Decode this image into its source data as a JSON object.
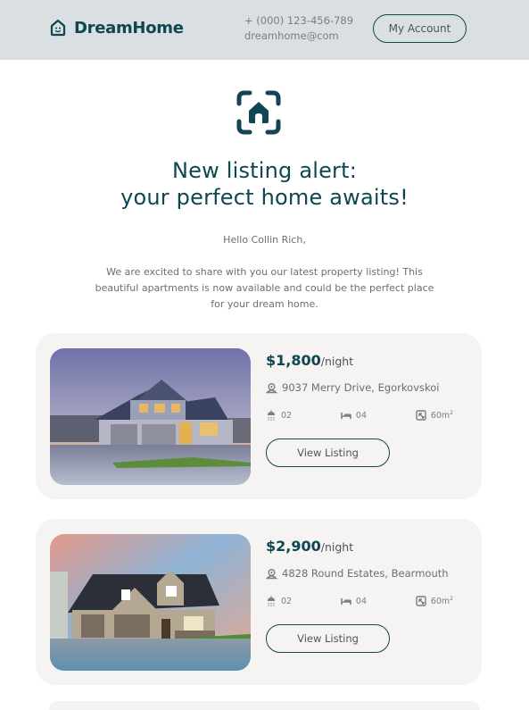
{
  "header": {
    "brand": "DreamHome",
    "phone": "+ (000) 123-456-789",
    "email": "dreamhome@com",
    "account_button": "My Account"
  },
  "hero": {
    "icon": "house-scan-icon",
    "title_line1": "New listing alert:",
    "title_line2": "your perfect home awaits!",
    "greeting": "Hello Collin Rich,",
    "intro": "We are excited to share with you our latest property listing! This beautiful apartments is now available and could be the perfect place for your dream home."
  },
  "colors": {
    "brand": "#0f4652",
    "header_bg": "#dadfe1",
    "card_bg": "#f6f4f2"
  },
  "listings": [
    {
      "price": "$1,800",
      "per": "/night",
      "address": "9037 Merry Drive, Egorkovskoi",
      "baths": "02",
      "beds": "04",
      "area": "60m",
      "area_unit_sup": "2",
      "button": "View Listing",
      "image": "house-photo-dusk"
    },
    {
      "price": "$2,900",
      "per": "/night",
      "address": "4828 Round Estates, Bearmouth",
      "baths": "02",
      "beds": "04",
      "area": "60m",
      "area_unit_sup": "2",
      "button": "View Listing",
      "image": "house-photo-sunset"
    }
  ]
}
